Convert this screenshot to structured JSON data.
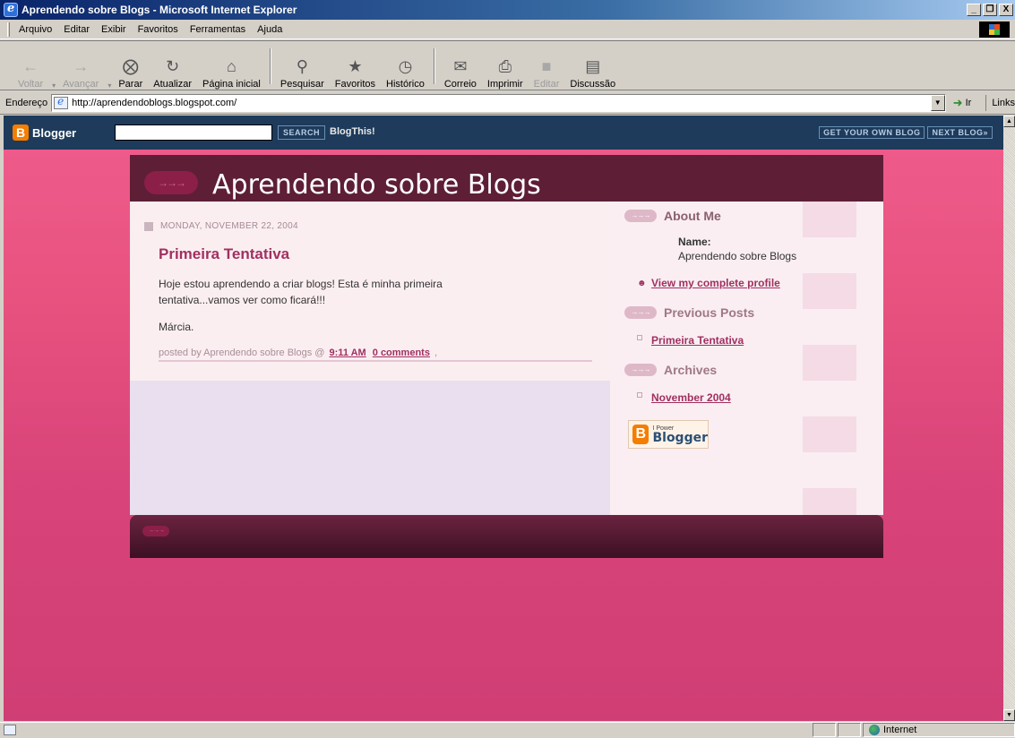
{
  "window": {
    "title": "Aprendendo sobre Blogs - Microsoft Internet Explorer",
    "buttons": [
      "_",
      "❐",
      "X"
    ]
  },
  "menu": [
    "Arquivo",
    "Editar",
    "Exibir",
    "Favoritos",
    "Ferramentas",
    "Ajuda"
  ],
  "toolbar": {
    "back": "Voltar",
    "forward": "Avançar",
    "stop": "Parar",
    "refresh": "Atualizar",
    "home": "Página inicial",
    "search": "Pesquisar",
    "favorites": "Favoritos",
    "history": "Histórico",
    "mail": "Correio",
    "print": "Imprimir",
    "edit": "Editar",
    "discuss": "Discussão"
  },
  "address": {
    "label": "Endereço",
    "url": "http://aprendendoblogs.blogspot.com/",
    "go": "Ir",
    "links": "Links"
  },
  "blogger_nav": {
    "logo": "Blogger",
    "search_button": "SEARCH",
    "blogthis": "BlogThis!",
    "get_own_blog": "GET YOUR OWN BLOG",
    "next_blog": "NEXT BLOG»"
  },
  "blog": {
    "title": "Aprendendo sobre Blogs",
    "post": {
      "date": "MONDAY, NOVEMBER 22, 2004",
      "title": "Primeira Tentativa",
      "body": "Hoje estou aprendendo a criar blogs! Esta é minha primeira tentativa...vamos ver como ficará!!!",
      "signature": "Márcia.",
      "posted_by": "posted by Aprendendo sobre Blogs @",
      "time": "9:11 AM",
      "comments": "0 comments",
      "trailing": ","
    },
    "sidebar": {
      "about_heading": "About Me",
      "name_label": "Name:",
      "name_value": "Aprendendo sobre Blogs",
      "profile_link": "View my complete profile",
      "previous_heading": "Previous Posts",
      "previous_items": [
        "Primeira Tentativa"
      ],
      "archives_heading": "Archives",
      "archive_items": [
        "November 2004"
      ],
      "powered_small": "I Power",
      "powered_big": "Blogger"
    }
  },
  "status": {
    "zone": "Internet"
  }
}
